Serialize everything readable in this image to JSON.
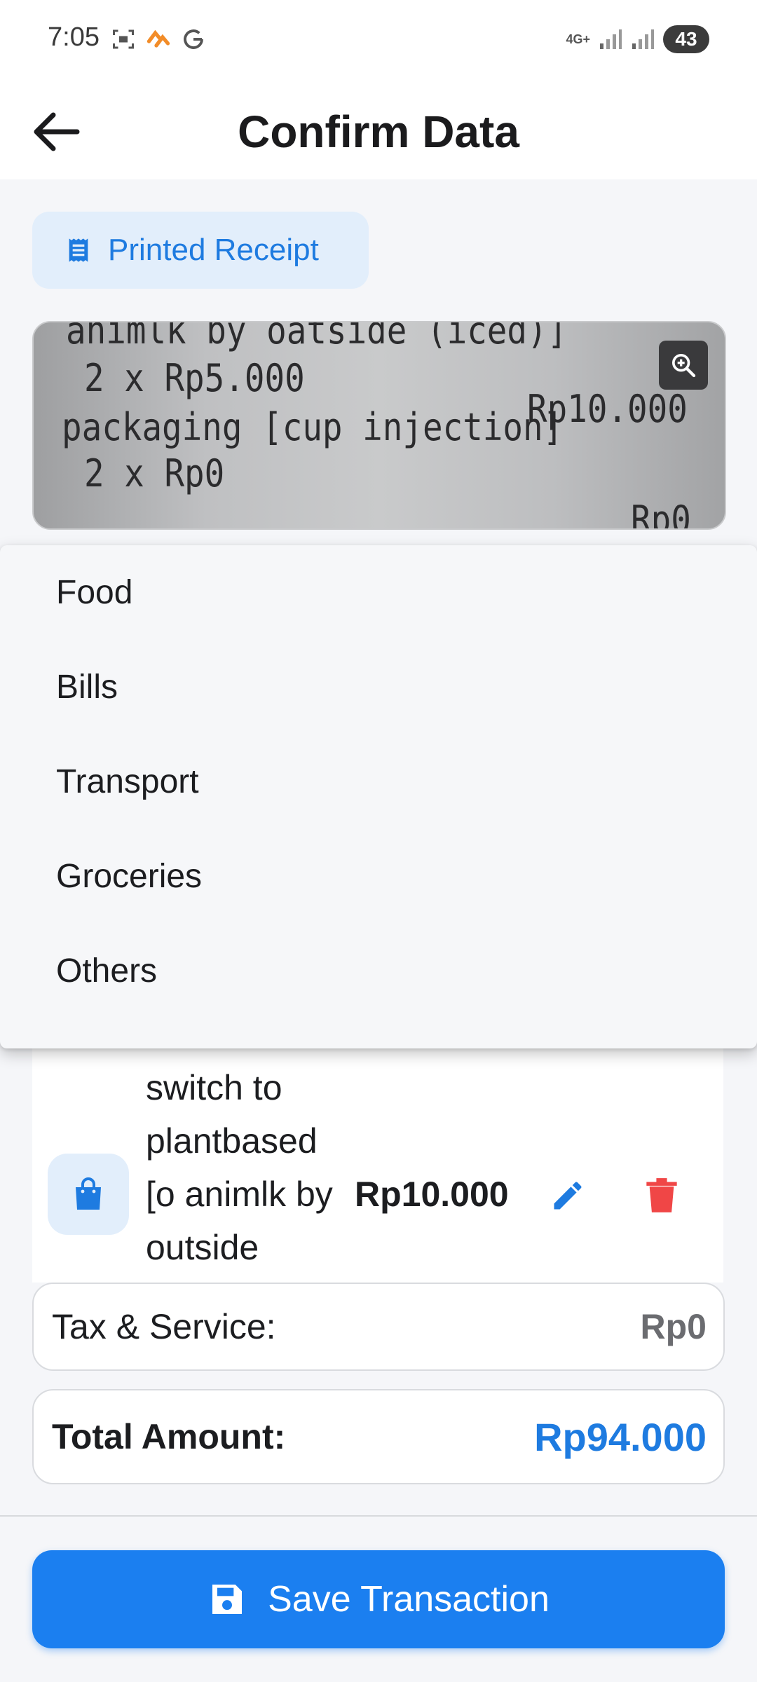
{
  "status_bar": {
    "time": "7:05",
    "network": "4G+",
    "battery": "43"
  },
  "app_bar": {
    "title": "Confirm Data"
  },
  "chip": {
    "label": "Printed Receipt"
  },
  "receipt": {
    "lines": [
      "animlk by oatside (iced)]",
      "2 x Rp5.000",
      "Rp10.000",
      "packaging [cup injection]",
      "2 x Rp0",
      "Rp0"
    ]
  },
  "category_menu": {
    "items": [
      "Food",
      "Bills",
      "Transport",
      "Groceries",
      "Others"
    ]
  },
  "item": {
    "name_lines": [
      "switch to",
      "plantbased",
      "[o animlk by",
      "outside"
    ],
    "price": "Rp10.000"
  },
  "summary": {
    "tax_label": "Tax & Service:",
    "tax_value": "Rp0",
    "total_label": "Total Amount:",
    "total_value": "Rp94.000"
  },
  "save_button": {
    "label": "Save Transaction"
  },
  "colors": {
    "accent": "#1B7FF0",
    "delete": "#F04646",
    "chip_bg": "#E2EEFB"
  }
}
